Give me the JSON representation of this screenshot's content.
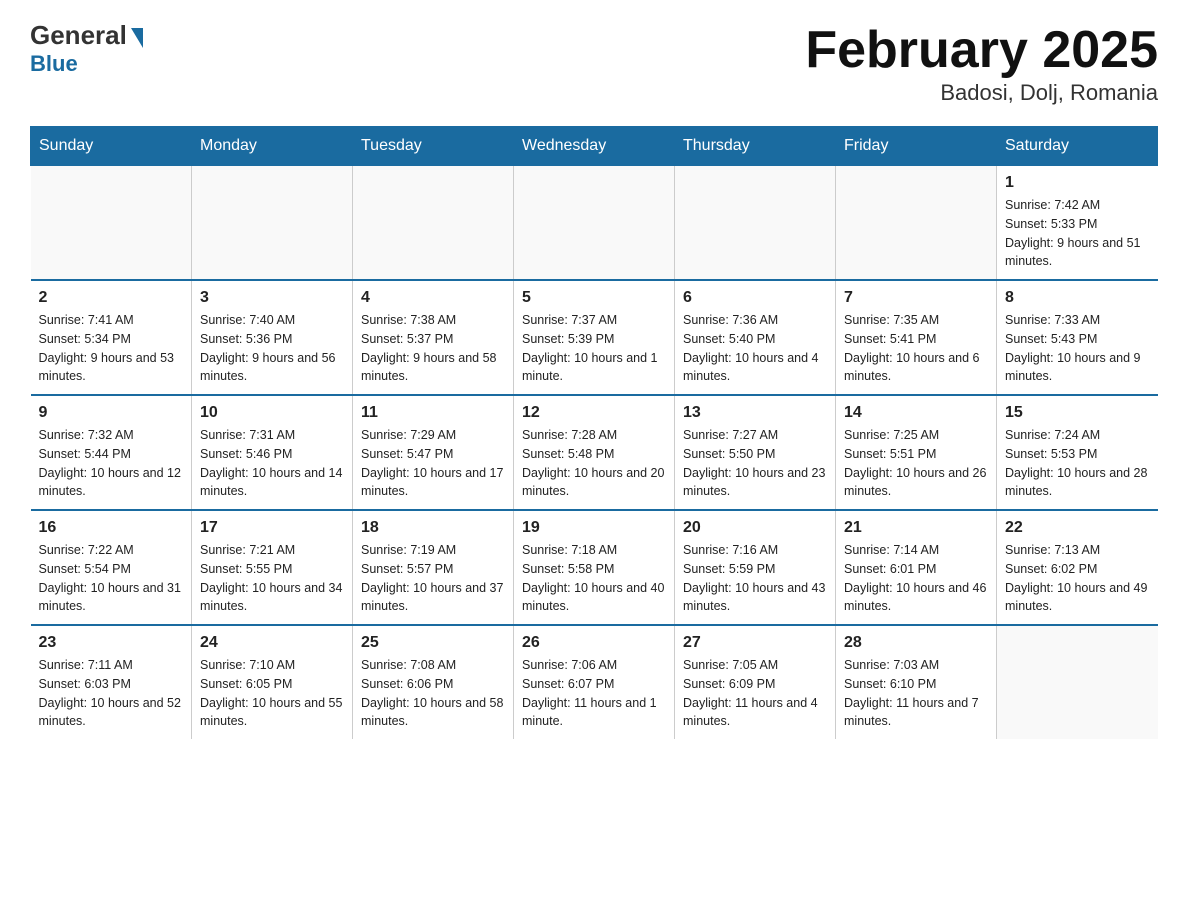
{
  "header": {
    "logo_general": "General",
    "logo_blue": "Blue",
    "month_title": "February 2025",
    "location": "Badosi, Dolj, Romania"
  },
  "days_of_week": [
    "Sunday",
    "Monday",
    "Tuesday",
    "Wednesday",
    "Thursday",
    "Friday",
    "Saturday"
  ],
  "weeks": [
    [
      {
        "day": "",
        "info": ""
      },
      {
        "day": "",
        "info": ""
      },
      {
        "day": "",
        "info": ""
      },
      {
        "day": "",
        "info": ""
      },
      {
        "day": "",
        "info": ""
      },
      {
        "day": "",
        "info": ""
      },
      {
        "day": "1",
        "info": "Sunrise: 7:42 AM\nSunset: 5:33 PM\nDaylight: 9 hours and 51 minutes."
      }
    ],
    [
      {
        "day": "2",
        "info": "Sunrise: 7:41 AM\nSunset: 5:34 PM\nDaylight: 9 hours and 53 minutes."
      },
      {
        "day": "3",
        "info": "Sunrise: 7:40 AM\nSunset: 5:36 PM\nDaylight: 9 hours and 56 minutes."
      },
      {
        "day": "4",
        "info": "Sunrise: 7:38 AM\nSunset: 5:37 PM\nDaylight: 9 hours and 58 minutes."
      },
      {
        "day": "5",
        "info": "Sunrise: 7:37 AM\nSunset: 5:39 PM\nDaylight: 10 hours and 1 minute."
      },
      {
        "day": "6",
        "info": "Sunrise: 7:36 AM\nSunset: 5:40 PM\nDaylight: 10 hours and 4 minutes."
      },
      {
        "day": "7",
        "info": "Sunrise: 7:35 AM\nSunset: 5:41 PM\nDaylight: 10 hours and 6 minutes."
      },
      {
        "day": "8",
        "info": "Sunrise: 7:33 AM\nSunset: 5:43 PM\nDaylight: 10 hours and 9 minutes."
      }
    ],
    [
      {
        "day": "9",
        "info": "Sunrise: 7:32 AM\nSunset: 5:44 PM\nDaylight: 10 hours and 12 minutes."
      },
      {
        "day": "10",
        "info": "Sunrise: 7:31 AM\nSunset: 5:46 PM\nDaylight: 10 hours and 14 minutes."
      },
      {
        "day": "11",
        "info": "Sunrise: 7:29 AM\nSunset: 5:47 PM\nDaylight: 10 hours and 17 minutes."
      },
      {
        "day": "12",
        "info": "Sunrise: 7:28 AM\nSunset: 5:48 PM\nDaylight: 10 hours and 20 minutes."
      },
      {
        "day": "13",
        "info": "Sunrise: 7:27 AM\nSunset: 5:50 PM\nDaylight: 10 hours and 23 minutes."
      },
      {
        "day": "14",
        "info": "Sunrise: 7:25 AM\nSunset: 5:51 PM\nDaylight: 10 hours and 26 minutes."
      },
      {
        "day": "15",
        "info": "Sunrise: 7:24 AM\nSunset: 5:53 PM\nDaylight: 10 hours and 28 minutes."
      }
    ],
    [
      {
        "day": "16",
        "info": "Sunrise: 7:22 AM\nSunset: 5:54 PM\nDaylight: 10 hours and 31 minutes."
      },
      {
        "day": "17",
        "info": "Sunrise: 7:21 AM\nSunset: 5:55 PM\nDaylight: 10 hours and 34 minutes."
      },
      {
        "day": "18",
        "info": "Sunrise: 7:19 AM\nSunset: 5:57 PM\nDaylight: 10 hours and 37 minutes."
      },
      {
        "day": "19",
        "info": "Sunrise: 7:18 AM\nSunset: 5:58 PM\nDaylight: 10 hours and 40 minutes."
      },
      {
        "day": "20",
        "info": "Sunrise: 7:16 AM\nSunset: 5:59 PM\nDaylight: 10 hours and 43 minutes."
      },
      {
        "day": "21",
        "info": "Sunrise: 7:14 AM\nSunset: 6:01 PM\nDaylight: 10 hours and 46 minutes."
      },
      {
        "day": "22",
        "info": "Sunrise: 7:13 AM\nSunset: 6:02 PM\nDaylight: 10 hours and 49 minutes."
      }
    ],
    [
      {
        "day": "23",
        "info": "Sunrise: 7:11 AM\nSunset: 6:03 PM\nDaylight: 10 hours and 52 minutes."
      },
      {
        "day": "24",
        "info": "Sunrise: 7:10 AM\nSunset: 6:05 PM\nDaylight: 10 hours and 55 minutes."
      },
      {
        "day": "25",
        "info": "Sunrise: 7:08 AM\nSunset: 6:06 PM\nDaylight: 10 hours and 58 minutes."
      },
      {
        "day": "26",
        "info": "Sunrise: 7:06 AM\nSunset: 6:07 PM\nDaylight: 11 hours and 1 minute."
      },
      {
        "day": "27",
        "info": "Sunrise: 7:05 AM\nSunset: 6:09 PM\nDaylight: 11 hours and 4 minutes."
      },
      {
        "day": "28",
        "info": "Sunrise: 7:03 AM\nSunset: 6:10 PM\nDaylight: 11 hours and 7 minutes."
      },
      {
        "day": "",
        "info": ""
      }
    ]
  ]
}
